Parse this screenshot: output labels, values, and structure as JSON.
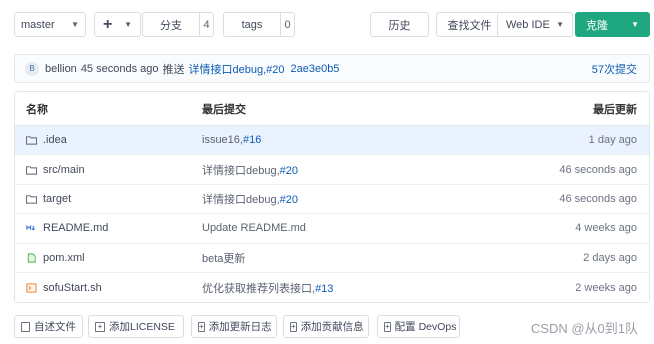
{
  "toolbar": {
    "branch": "master",
    "plus": "+",
    "branches_label": "分支",
    "branches_count": "4",
    "tags_label": "tags",
    "tags_count": "0",
    "history": "历史",
    "find_file": "查找文件",
    "web_ide": "Web IDE",
    "clone": "克隆",
    "clone_color": "#1fa880"
  },
  "commit": {
    "avatar_letter": "B",
    "author": "bellion",
    "time": "45 seconds ago",
    "action": "推送",
    "message": "详情接口debug,#20",
    "hash": "2ae3e0b5",
    "count": "57次提交"
  },
  "table": {
    "headers": {
      "name": "名称",
      "commit": "最后提交",
      "time": "最后更新"
    },
    "rows": [
      {
        "icon": "folder-icon",
        "name": ".idea",
        "commit_text": "issue16,",
        "commit_link": "#16",
        "time": "1 day ago"
      },
      {
        "icon": "folder-icon",
        "name": "src/main",
        "commit_text": "详情接口debug,",
        "commit_link": "#20",
        "time": "46 seconds ago"
      },
      {
        "icon": "folder-icon",
        "name": "target",
        "commit_text": "详情接口debug,",
        "commit_link": "#20",
        "time": "46 seconds ago"
      },
      {
        "icon": "markdown-icon",
        "name": "README.md",
        "commit_text": "Update README.md",
        "commit_link": "",
        "time": "4 weeks ago"
      },
      {
        "icon": "xml-file-icon",
        "name": "pom.xml",
        "commit_text": "beta更新",
        "commit_link": "",
        "time": "2 days ago"
      },
      {
        "icon": "shell-file-icon",
        "name": "sofuStart.sh",
        "commit_text": "优化获取推荐列表接口,",
        "commit_link": "#13",
        "time": "2 weeks ago"
      }
    ]
  },
  "bottom": {
    "readme": "自述文件",
    "license": "添加LICENSE",
    "changelog": "添加更新日志",
    "contributing": "添加贡献信息",
    "devops": "配置 DevOps"
  },
  "watermark": "CSDN @从0到1队"
}
